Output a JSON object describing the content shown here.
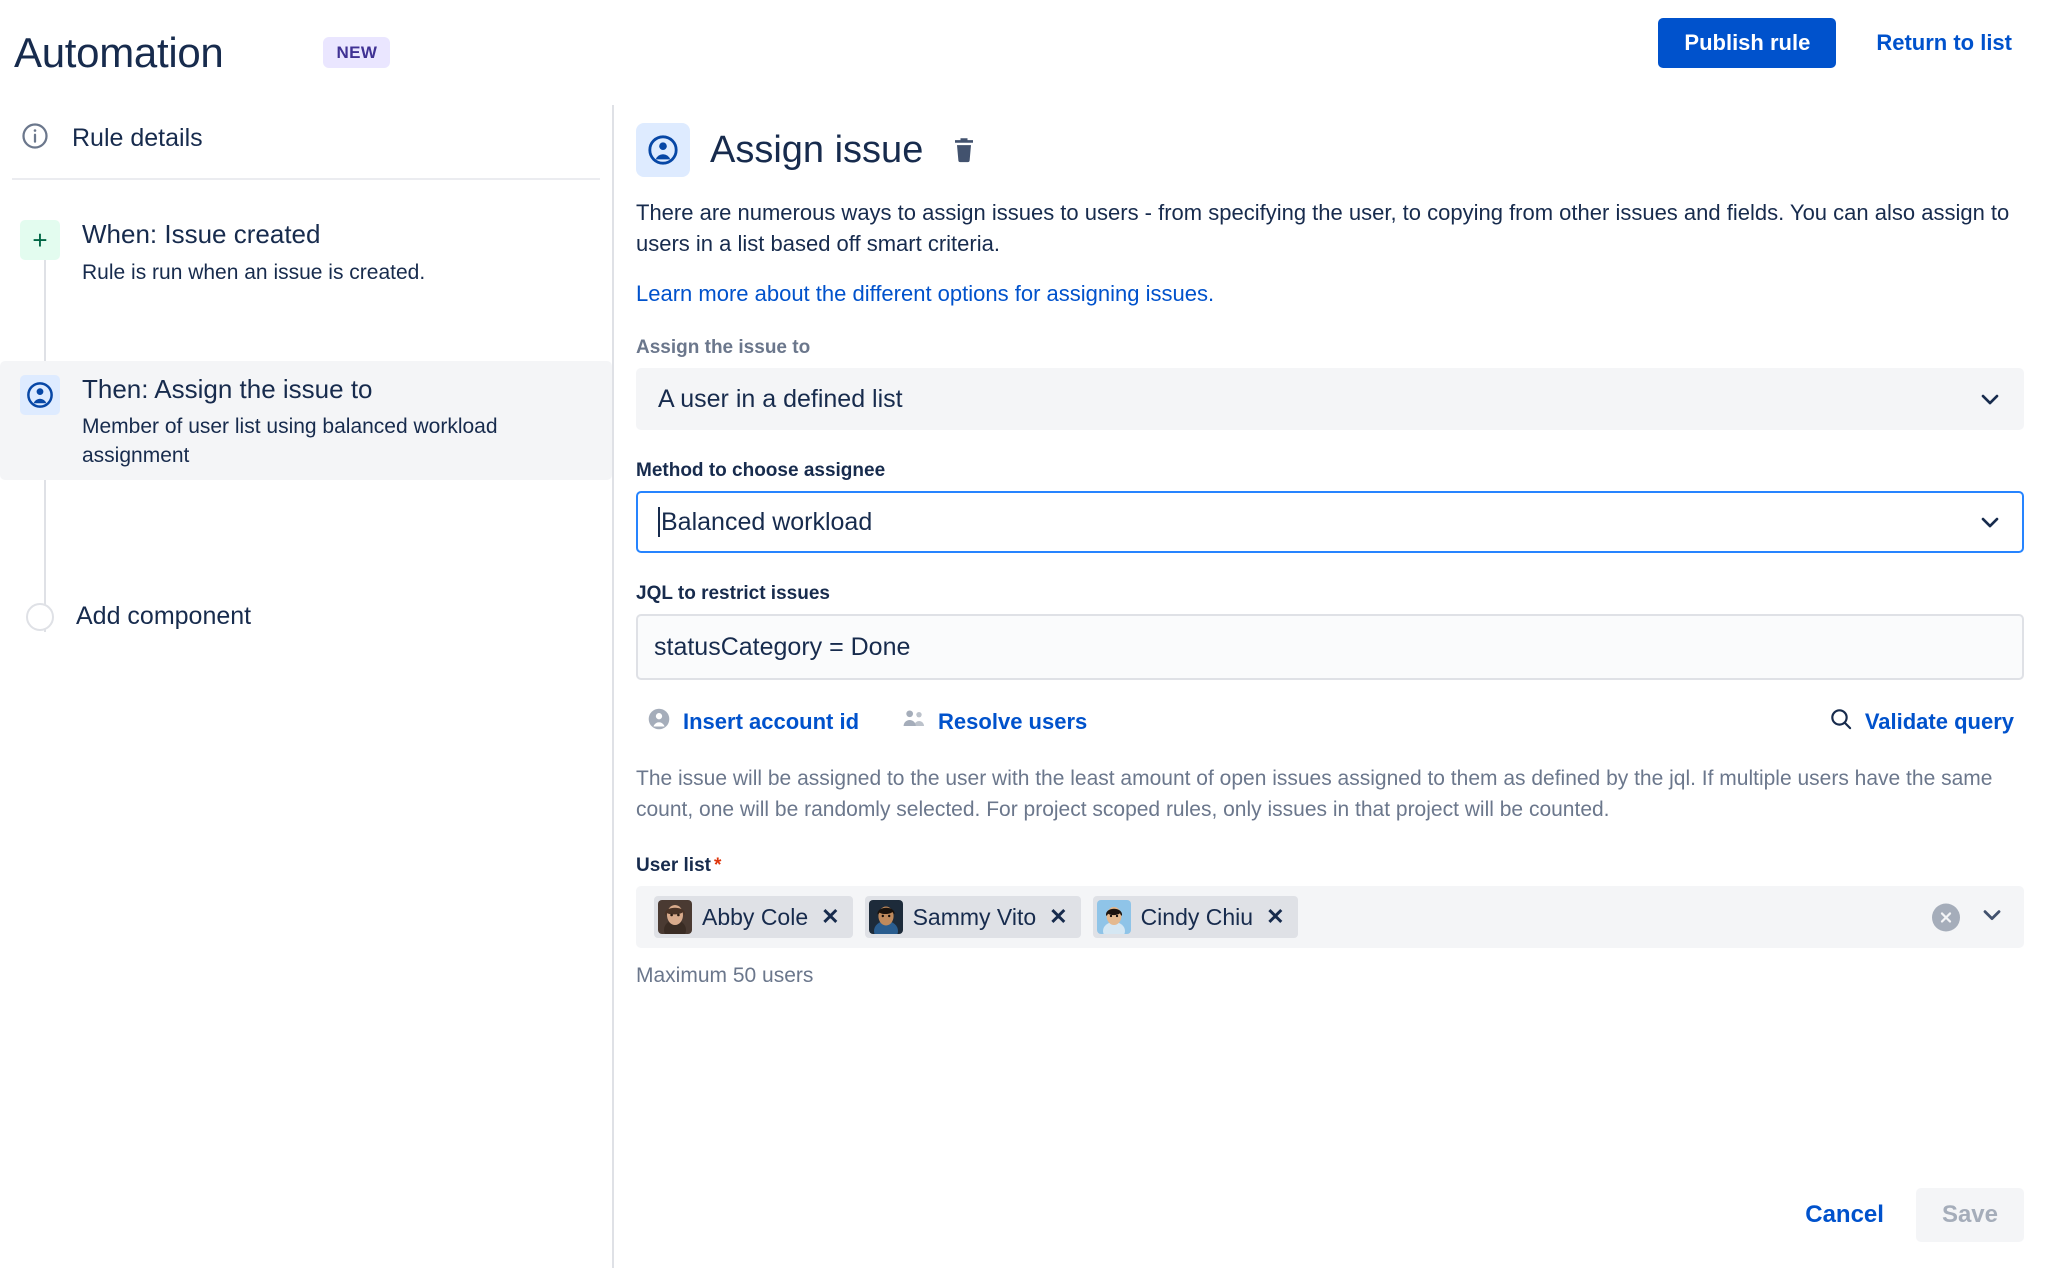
{
  "header": {
    "app_title": "Automation",
    "badge": "NEW",
    "publish_label": "Publish rule",
    "return_label": "Return to list",
    "accent": "#0052CC",
    "badge_bg": "#EAE6FF",
    "badge_fg": "#403294"
  },
  "sidebar": {
    "rule_details": "Rule details",
    "steps": [
      {
        "icon": "plus-icon",
        "title": "When: Issue created",
        "desc": "Rule is run when an issue is created.",
        "active": false
      },
      {
        "icon": "assign-user-icon",
        "title": "Then: Assign the issue to",
        "desc": "Member of user list using balanced workload assignment",
        "active": true
      }
    ],
    "add_component": "Add component"
  },
  "main": {
    "action_title": "Assign issue",
    "intro": "There are numerous ways to assign issues to users - from specifying the user, to copying from other issues and fields. You can also assign to users in a list based off smart criteria.",
    "learn_more": "Learn more about the different options for assigning issues.",
    "assign_to": {
      "label": "Assign the issue to",
      "value": "A user in a defined list"
    },
    "method": {
      "label": "Method to choose assignee",
      "value": "Balanced workload",
      "focused": true
    },
    "jql": {
      "label": "JQL to restrict issues",
      "value": "statusCategory = Done",
      "insert_account_id": "Insert account id",
      "resolve_users": "Resolve users",
      "validate_query": "Validate query"
    },
    "help_text": "The issue will be assigned to the user with the least amount of open issues assigned to them as defined by the jql. If multiple users have the same count, one will be randomly selected. For project scoped rules, only issues in that project will be counted.",
    "user_list": {
      "label": "User list",
      "required": true,
      "users": [
        {
          "name": "Abby Cole",
          "avatar_colors": [
            "#6b4a3a",
            "#d8b49a"
          ]
        },
        {
          "name": "Sammy Vito",
          "avatar_colors": [
            "#2a2118",
            "#c98f62"
          ]
        },
        {
          "name": "Cindy Chiu",
          "avatar_colors": [
            "#8fc4e8",
            "#e8c39e"
          ]
        }
      ],
      "max_note": "Maximum 50 users"
    },
    "cancel_label": "Cancel",
    "save_label": "Save"
  }
}
